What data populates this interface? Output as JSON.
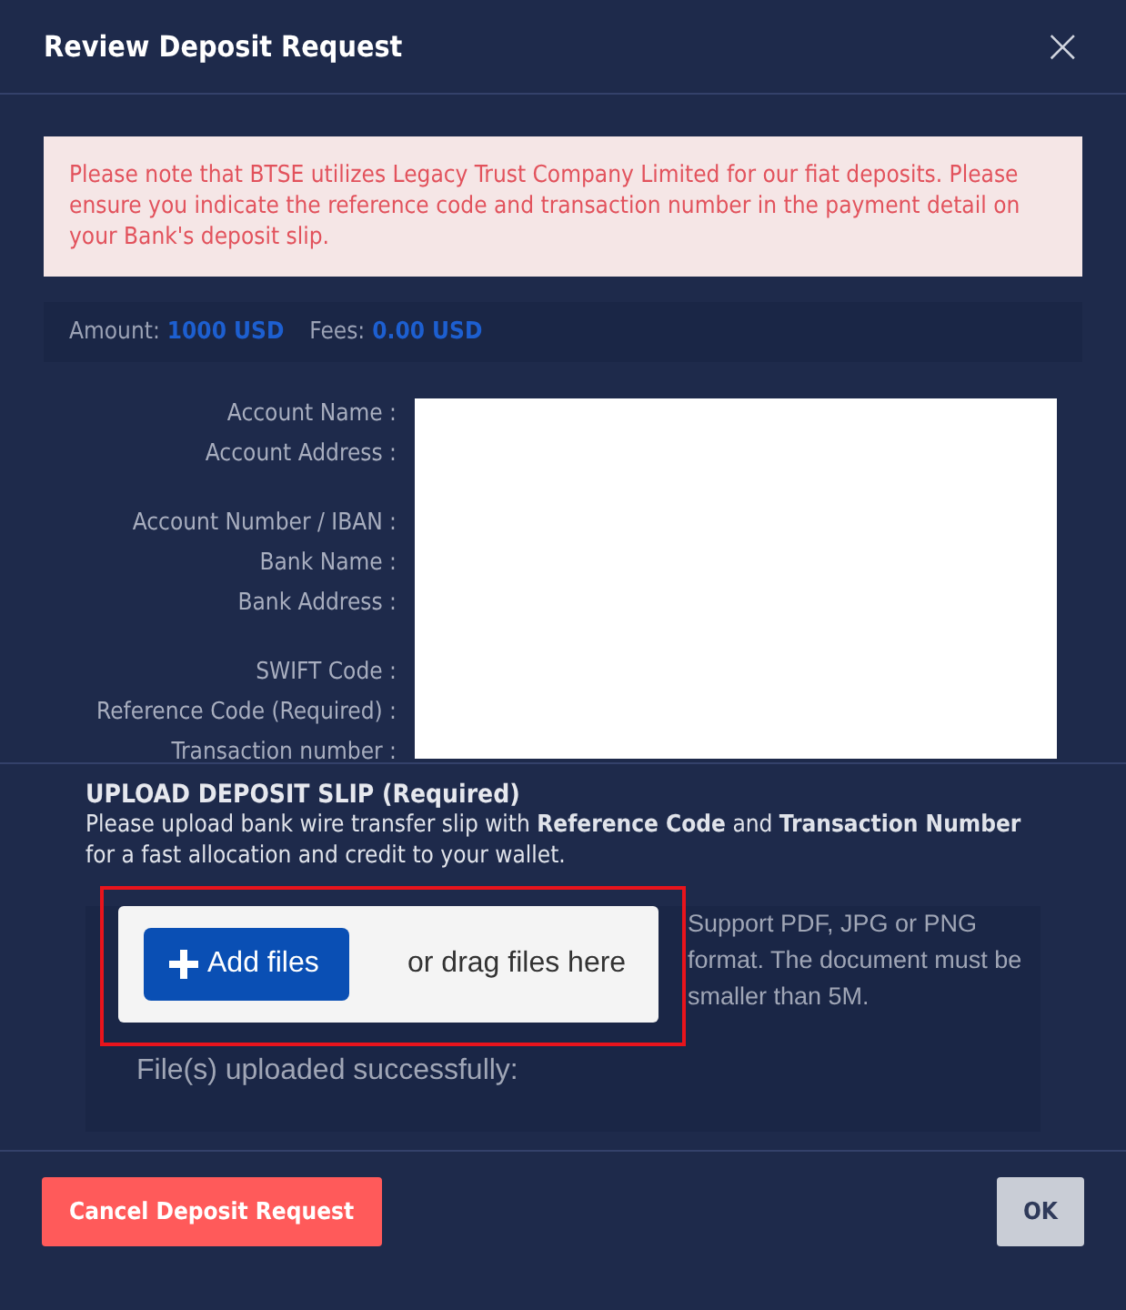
{
  "dialog": {
    "title": "Review Deposit Request",
    "close": "×"
  },
  "notice": "Please note that BTSE utilizes Legacy Trust Company Limited for our fiat deposits. Please ensure you indicate the reference code and transaction number in the payment detail on your Bank's deposit slip.",
  "summary": [
    {
      "label": "Amount:",
      "value": "1000 USD"
    },
    {
      "label": "Fees:",
      "value": "0.00 USD"
    }
  ],
  "details": [
    {
      "label": "Account Name :",
      "kind": "single"
    },
    {
      "label": "Account Address :",
      "kind": "double"
    },
    {
      "label": "Account Number / IBAN :",
      "kind": "single"
    },
    {
      "label": "Bank Name :",
      "kind": "single"
    },
    {
      "label": "Bank Address :",
      "kind": "double"
    },
    {
      "label": "SWIFT Code :",
      "kind": "single"
    },
    {
      "label": "Reference Code (Required) :",
      "kind": "single"
    },
    {
      "label": "Transaction number :",
      "kind": "single"
    }
  ],
  "upload": {
    "title": "UPLOAD DEPOSIT SLIP (Required)",
    "description": "Please upload bank wire transfer slip with **Reference Code** and **Transaction Number** for a fast allocation and credit to your wallet.",
    "add_button": "Add files",
    "drag_hint": "or drag files here",
    "help": "Support PDF, JPG or PNG format. The document must be smaller than 5M.",
    "status": "File(s) uploaded successfully:",
    "highlighted": true
  },
  "buttons": [
    {
      "label": "Cancel Deposit Request",
      "kind": "danger"
    },
    {
      "label": "OK",
      "kind": "neutral"
    }
  ]
}
